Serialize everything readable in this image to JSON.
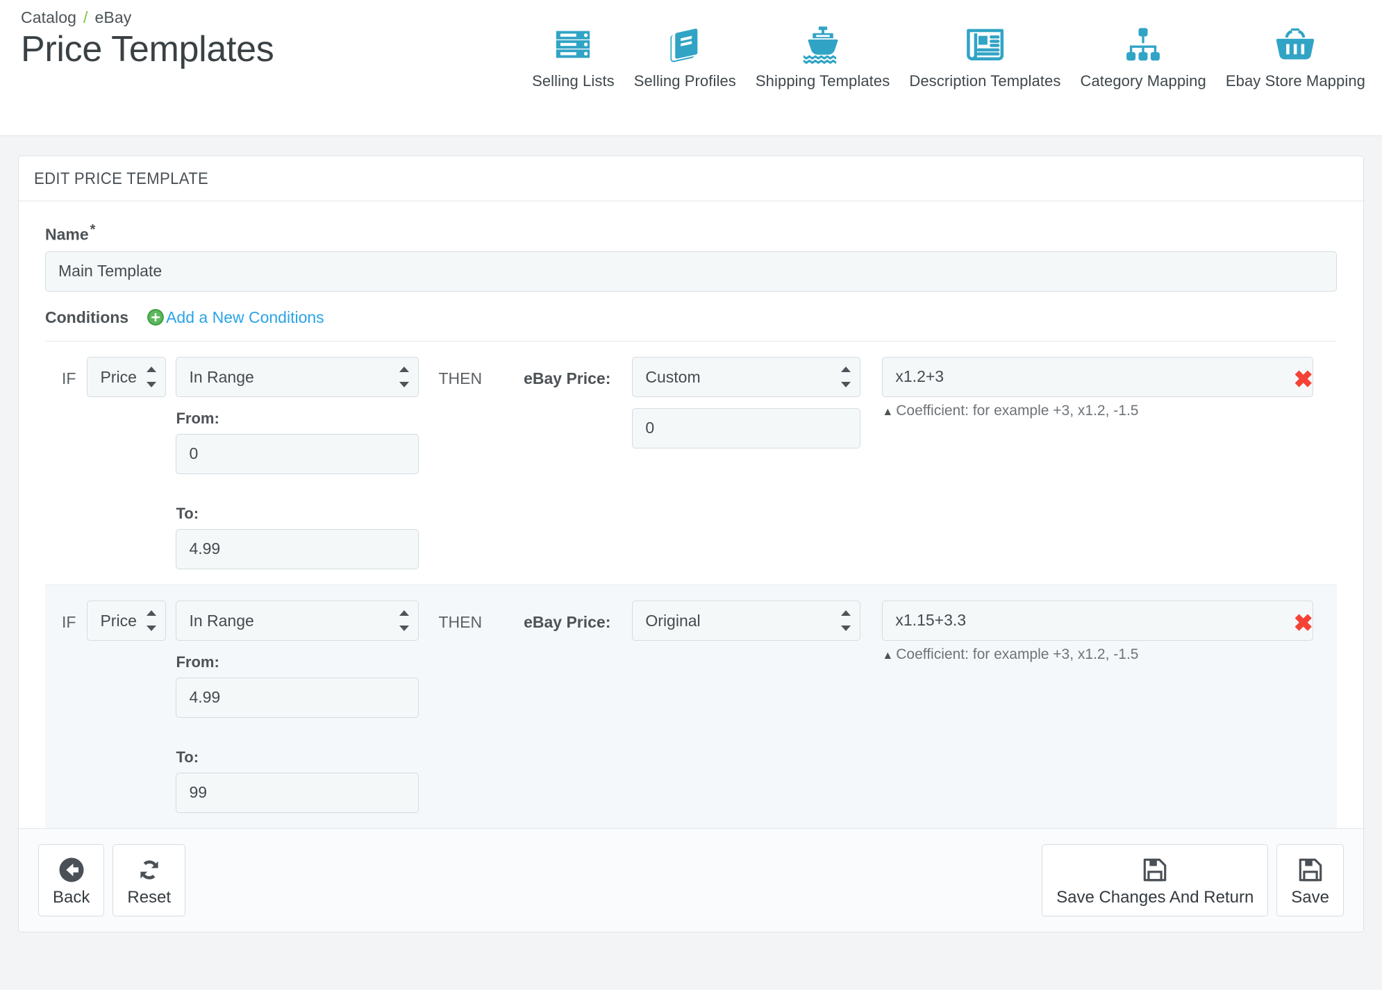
{
  "header": {
    "breadcrumb": {
      "root": "Catalog",
      "separator": "/",
      "current": "eBay"
    },
    "title": "Price Templates",
    "nav": [
      {
        "label": "Selling Lists",
        "icon": "server-stack-icon"
      },
      {
        "label": "Selling Profiles",
        "icon": "book-icon"
      },
      {
        "label": "Shipping Templates",
        "icon": "ship-icon"
      },
      {
        "label": "Description Templates",
        "icon": "newspaper-icon"
      },
      {
        "label": "Category Mapping",
        "icon": "sitemap-icon"
      },
      {
        "label": "Ebay Store Mapping",
        "icon": "shopping-basket-icon"
      }
    ]
  },
  "panel": {
    "heading": "EDIT PRICE TEMPLATE",
    "name_label": "Name",
    "required_mark": "*",
    "name_value": "Main Template",
    "conditions_label": "Conditions",
    "add_conditions_label": "Add a New Conditions",
    "if_label": "IF",
    "then_label": "THEN",
    "ebay_price_label": "eBay Price:",
    "from_label": "From:",
    "to_label": "To:",
    "coefficient_hint": "Coefficient: for example +3, x1.2, -1.5",
    "delete_symbol": "✖",
    "conditions": [
      {
        "field": "Price",
        "operator": "In Range",
        "from": "0",
        "to": "4.99",
        "price_mode": "Custom",
        "mode_extra_value": "0",
        "coefficient": "x1.2+3"
      },
      {
        "field": "Price",
        "operator": "In Range",
        "from": "4.99",
        "to": "99",
        "price_mode": "Original",
        "mode_extra_value": "",
        "coefficient": "x1.15+3.3"
      }
    ]
  },
  "footer": {
    "back_label": "Back",
    "reset_label": "Reset",
    "save_return_label": "Save Changes And Return",
    "save_label": "Save"
  },
  "colors": {
    "accent": "#31a4c6",
    "link": "#2aa3e8",
    "breadcrumb_sep": "#7cc242",
    "danger": "#f44336",
    "add_icon": "#4caf50"
  }
}
